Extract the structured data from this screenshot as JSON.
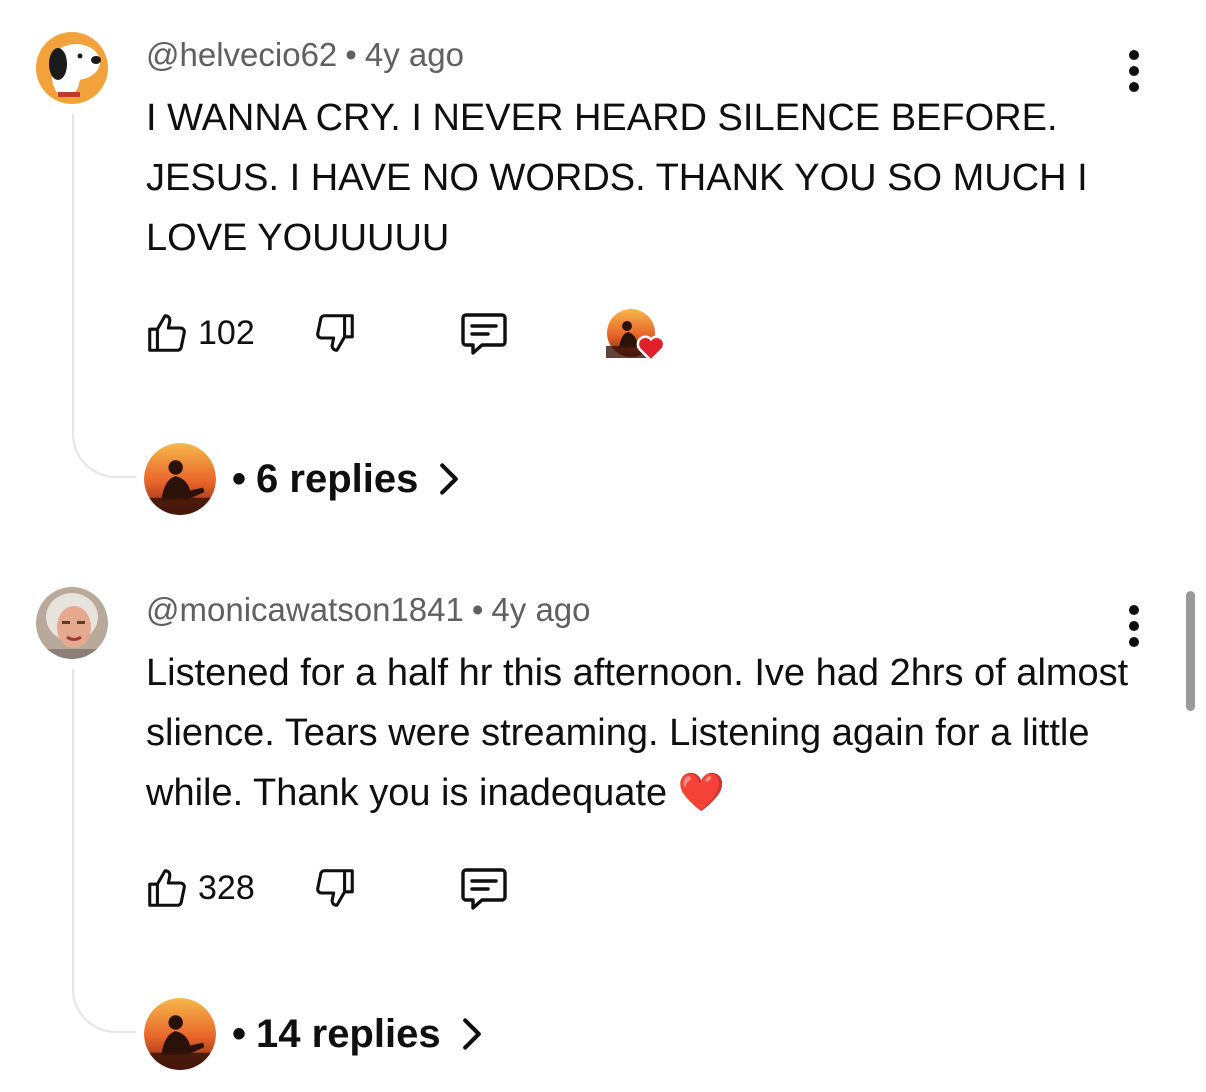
{
  "comments": [
    {
      "author": "@helvecio62",
      "separator": "•",
      "age": "4y ago",
      "text": "I WANNA CRY. I NEVER HEARD SILENCE BEFORE. JESUS. I HAVE NO WORDS. THANK YOU SO MUCH I LOVE YOUUUUU",
      "likes": "102",
      "creator_hearted": true,
      "replies_bullet": "•",
      "replies_label": "6 replies",
      "avatar_icon": "snoopy-avatar"
    },
    {
      "author": "@monicawatson1841",
      "separator": "•",
      "age": "4y ago",
      "text": "Listened for a half hr this afternoon. Ive had 2hrs of almost slience. Tears were streaming. Listening again for a little while. Thank you is inadequate ❤️",
      "likes": "328",
      "creator_hearted": false,
      "replies_bullet": "•",
      "replies_label": "14 replies",
      "avatar_icon": "woman-portrait-avatar"
    }
  ],
  "icons": {
    "like": "thumbs-up-icon",
    "dislike": "thumbs-down-icon",
    "reply": "comment-icon",
    "more": "more-vertical-icon",
    "chevron": "chevron-right-icon",
    "creator_avatar": "sunset-guitarist-avatar",
    "heart": "heart-icon"
  },
  "colors": {
    "text": "#0f0f0f",
    "secondary_text": "#606060",
    "heart": "#e0202a",
    "thread_line": "#e5e5e5",
    "scrollbar": "#9a9a9a"
  }
}
